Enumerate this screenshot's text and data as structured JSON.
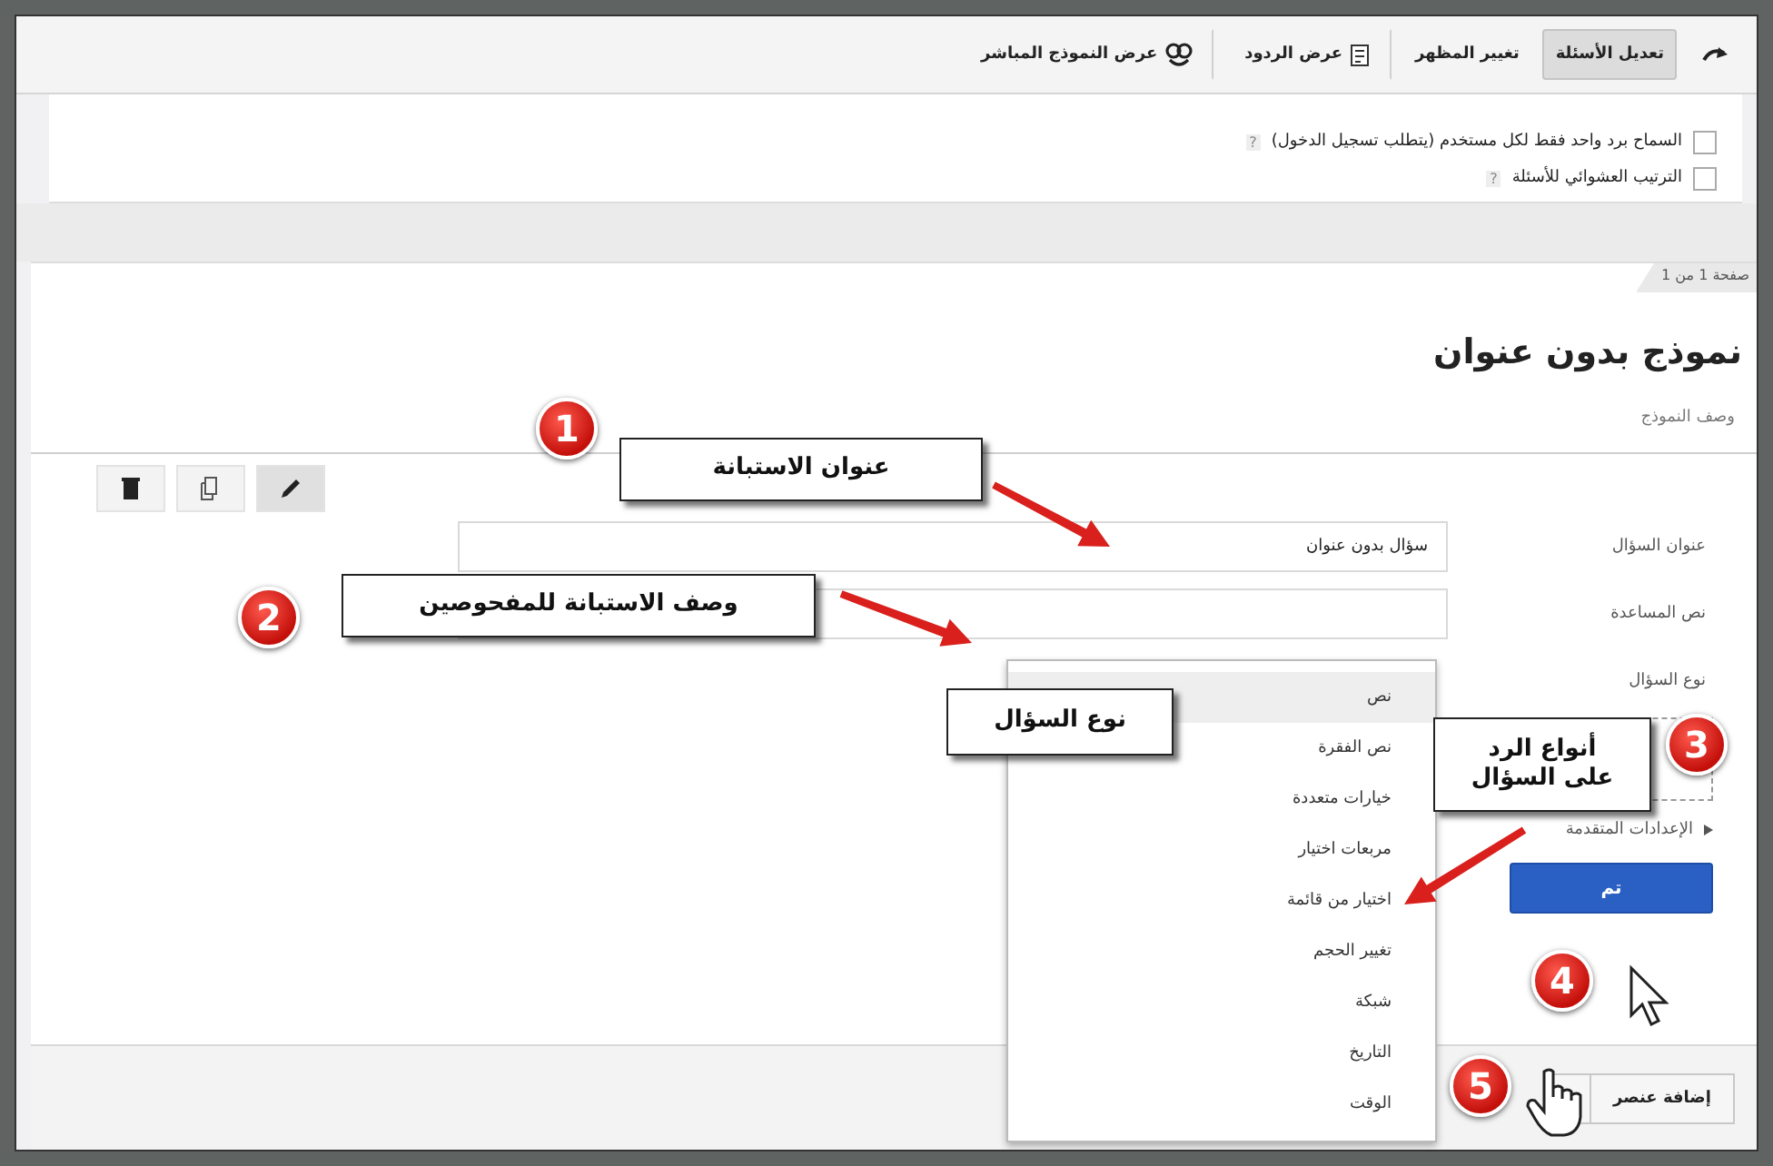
{
  "toolbar": {
    "items": [
      {
        "kind": "redo",
        "selected": false
      },
      {
        "kind": "tab",
        "label": "تعديل الأسئلة",
        "selected": true
      },
      {
        "kind": "tab",
        "label": "تغيير المظهر",
        "selected": false
      },
      {
        "kind": "responses",
        "label": "عرض الردود",
        "selected": false
      },
      {
        "kind": "live",
        "label": "عرض النموذج المباشر",
        "selected": false
      }
    ]
  },
  "settings": [
    {
      "label": "السماح برد واحد فقط لكل مستخدم (يتطلب تسجيل الدخول)",
      "checked": false,
      "help": "?"
    },
    {
      "label": "الترتيب العشوائي للأسئلة",
      "checked": false,
      "help": "?"
    }
  ],
  "page_indicator": "صفحة 1 من 1",
  "form": {
    "title": "نموذج بدون عنوان",
    "description": "وصف النموذج"
  },
  "question": {
    "tools": [
      {
        "kind": "edit",
        "selected": true
      },
      {
        "kind": "duplicate",
        "selected": false
      },
      {
        "kind": "delete",
        "selected": false
      }
    ],
    "title_label": "عنوان السؤال",
    "title_value": "سؤال بدون عنوان",
    "help_label": "نص المساعدة",
    "type_label": "نوع السؤال",
    "type_menu": [
      {
        "label": "نص",
        "selected": true
      },
      {
        "label": "نص الفقرة",
        "selected": false
      },
      {
        "label": "خيارات متعددة",
        "selected": false
      },
      {
        "label": "مربعات اختيار",
        "selected": false
      },
      {
        "label": "اختيار من قائمة",
        "selected": false
      },
      {
        "label": "تغيير الحجم",
        "selected": false
      },
      {
        "label": "شبكة",
        "selected": false
      },
      {
        "label": "التاريخ",
        "selected": false
      },
      {
        "label": "الوقت",
        "selected": false
      }
    ],
    "advanced": "الإعدادات المتقدمة",
    "done_button": "تم"
  },
  "add_item_button": "إضافة عنصر",
  "annotations": {
    "markers": [
      {
        "number": "1"
      },
      {
        "number": "2"
      },
      {
        "number": "3"
      },
      {
        "number": "4"
      },
      {
        "number": "5"
      }
    ],
    "callouts": [
      {
        "text": "عنوان الاستبانة"
      },
      {
        "text": "وصف الاستبانة للمفحوصين"
      },
      {
        "text": "نوع السؤال"
      },
      {
        "text": "أنواع الرد\nعلى السؤال"
      }
    ]
  }
}
